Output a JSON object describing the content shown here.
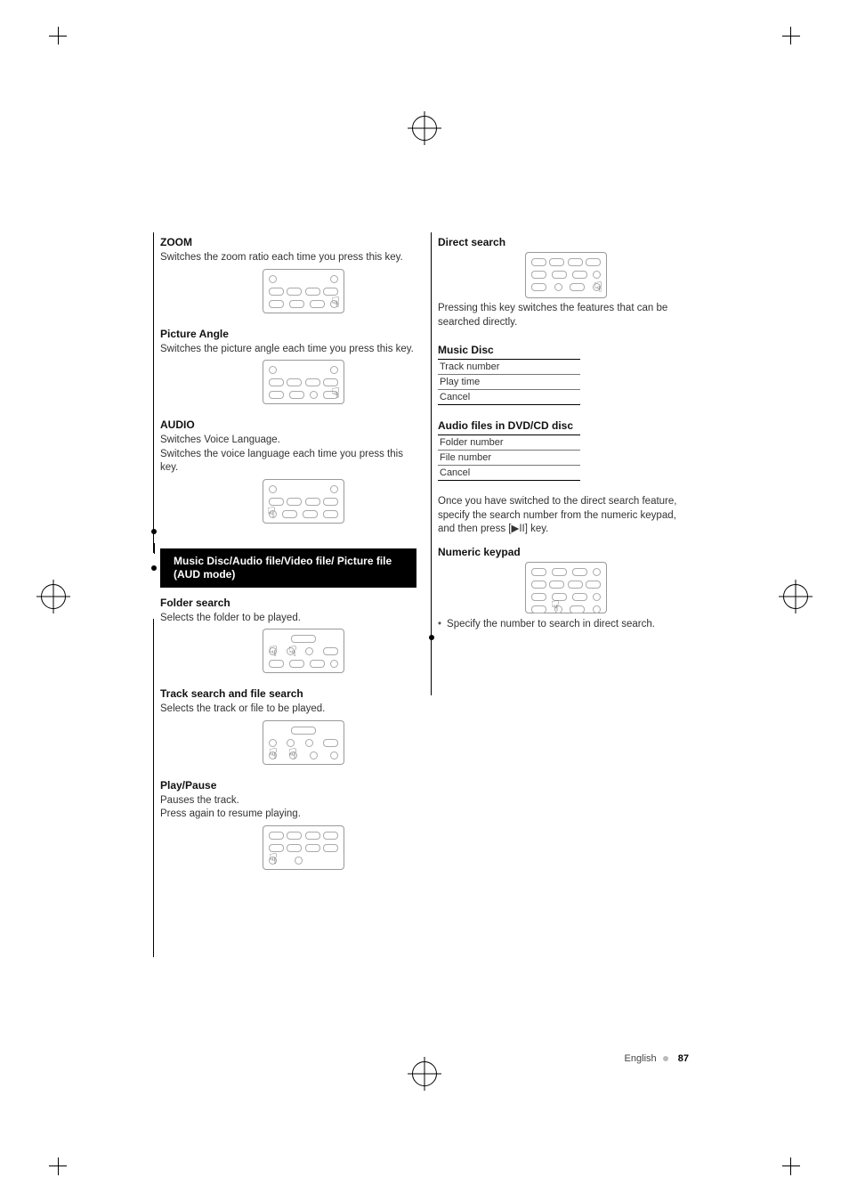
{
  "left": {
    "zoom": {
      "title": "ZOOM",
      "body": "Switches the zoom ratio each time you press this key."
    },
    "pictureAngle": {
      "title": "Picture Angle",
      "body": "Switches the picture angle each time you press this key."
    },
    "audio": {
      "title": "AUDIO",
      "line1": "Switches Voice Language.",
      "line2": "Switches the voice language each time you press this key."
    },
    "blackBar": "Music Disc/Audio file/Video file/ Picture file (AUD mode)",
    "folderSearch": {
      "title": "Folder search",
      "body": "Selects the folder to be played."
    },
    "trackSearch": {
      "title": "Track search and file search",
      "body": "Selects the track or file to be played."
    },
    "playPause": {
      "title": "Play/Pause",
      "line1": "Pauses the track.",
      "line2": "Press again to resume playing."
    }
  },
  "right": {
    "directSearch": {
      "title": "Direct search",
      "body": "Pressing this key switches the features that can be searched directly."
    },
    "musicDisc": {
      "title": "Music Disc",
      "rows": [
        "Track number",
        "Play time",
        "Cancel"
      ]
    },
    "audioFiles": {
      "title": "Audio files in DVD/CD disc",
      "rows": [
        "Folder number",
        "File number",
        "Cancel"
      ]
    },
    "afterTables": "Once you have switched to the direct search feature, specify the search number from the numeric keypad, and then press [▶II] key.",
    "numericKeypad": {
      "title": "Numeric keypad",
      "bullet": "Specify the number to search in direct search."
    }
  },
  "footer": {
    "lang": "English",
    "page": "87"
  }
}
